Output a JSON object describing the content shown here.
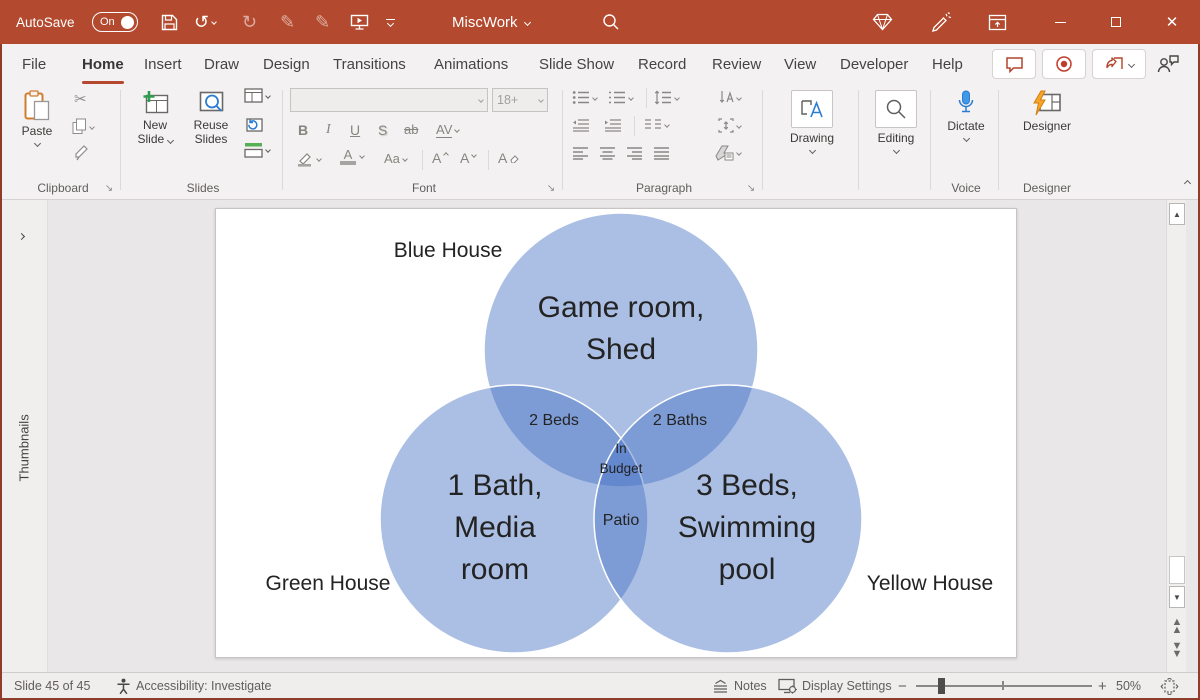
{
  "window": {
    "autosave_label": "AutoSave",
    "autosave_state": "On",
    "title": "MiscWork",
    "accent_color": "#b3492e"
  },
  "icons": {
    "undo": "↺",
    "redo": "↻",
    "ink_pen": "✎",
    "ink_highlighter": "✎",
    "cut": "✂",
    "minimize": "—",
    "close": "✕",
    "launcher": "↘",
    "scroll_up": "▲",
    "scroll_down": "▼",
    "prev_slide": "▲▲",
    "next_slide": "▼▼"
  },
  "tabs": [
    {
      "label": "File"
    },
    {
      "label": "Home",
      "active": true
    },
    {
      "label": "Insert"
    },
    {
      "label": "Draw"
    },
    {
      "label": "Design"
    },
    {
      "label": "Transitions"
    },
    {
      "label": "Animations"
    },
    {
      "label": "Slide Show"
    },
    {
      "label": "Record"
    },
    {
      "label": "Review"
    },
    {
      "label": "View"
    },
    {
      "label": "Developer"
    },
    {
      "label": "Help"
    }
  ],
  "ribbon": {
    "clipboard": {
      "group": "Clipboard",
      "paste": "Paste"
    },
    "slides": {
      "group": "Slides",
      "new_line1": "New",
      "new_line2": "Slide",
      "reuse_line1": "Reuse",
      "reuse_line2": "Slides"
    },
    "font": {
      "group": "Font",
      "size_value": "18+",
      "bold": "B",
      "italic": "I",
      "underline": "U",
      "shadow": "S",
      "strikethrough": "ab",
      "char_spacing": "AV",
      "change_case": "Aa",
      "grow_font": "A",
      "shrink_font": "A",
      "clear_format": "A"
    },
    "paragraph": {
      "group": "Paragraph"
    },
    "drawing": {
      "label": "Drawing",
      "icon_letter": "A"
    },
    "editing": {
      "label": "Editing"
    },
    "voice": {
      "group": "Voice",
      "dictate": "Dictate"
    },
    "designer": {
      "group": "Designer",
      "label": "Designer"
    }
  },
  "thumbnails": {
    "label": "Thumbnails"
  },
  "slide": {
    "venn": {
      "type": "venn-3",
      "circle_fill": "#4472C4",
      "circle_opacity": 0.45,
      "sets": [
        {
          "name": "Blue House",
          "unique_items": "Game room, Shed"
        },
        {
          "name": "Green House",
          "unique_items": "1 Bath, Media room"
        },
        {
          "name": "Yellow House",
          "unique_items": "3 Beds, Swimming pool"
        }
      ],
      "intersections": [
        {
          "between": [
            "Blue House",
            "Green House"
          ],
          "label": "2 Beds"
        },
        {
          "between": [
            "Blue House",
            "Yellow House"
          ],
          "label": "2 Baths"
        },
        {
          "between": [
            "Green House",
            "Yellow House"
          ],
          "label": "Patio"
        },
        {
          "between": [
            "Blue House",
            "Green House",
            "Yellow House"
          ],
          "label": "In Budget"
        }
      ]
    },
    "labels": {
      "blue_house": "Blue House",
      "green_house": "Green House",
      "yellow_house": "Yellow House",
      "blue_l1": "Game room,",
      "blue_l2": "Shed",
      "green_l1": "1 Bath,",
      "green_l2": "Media",
      "green_l3": "room",
      "yellow_l1": "3 Beds,",
      "yellow_l2": "Swimming",
      "yellow_l3": "pool",
      "blue_green": "2 Beds",
      "blue_yellow": "2 Baths",
      "center_l1": "In",
      "center_l2": "Budget",
      "green_yellow": "Patio"
    }
  },
  "statusbar": {
    "slide_info": "Slide 45 of 45",
    "accessibility": "Accessibility: Investigate",
    "notes": "Notes",
    "display_settings": "Display Settings",
    "zoom_minus": "−",
    "zoom_plus": "+",
    "zoom_level": "50%"
  }
}
